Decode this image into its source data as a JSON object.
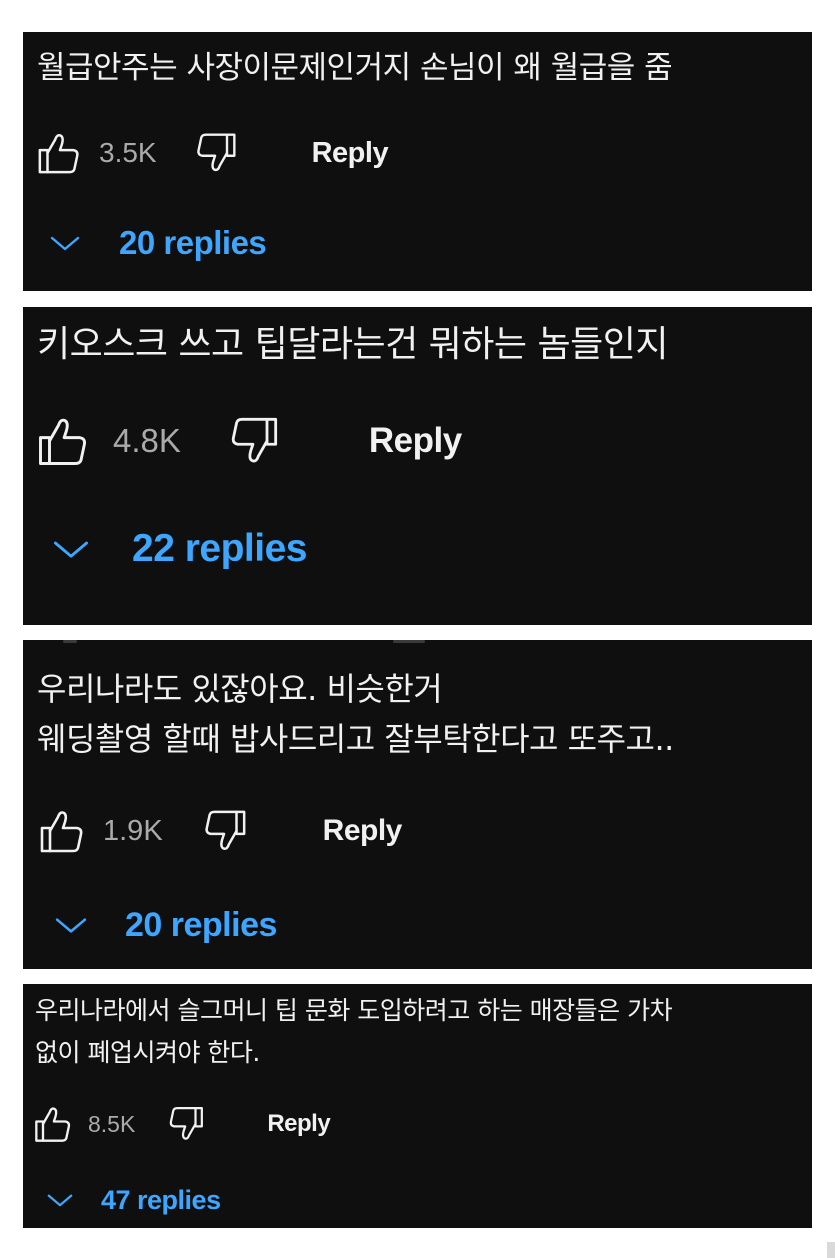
{
  "comments": [
    {
      "lines": [
        "월급안주는 사장이문제인거지 손님이 왜 월급을 줌"
      ],
      "likes": "3.5K",
      "reply_label": "Reply",
      "replies_label": "20 replies",
      "icons": {
        "like": "thumbs-up-icon",
        "dislike": "thumbs-down-icon",
        "expand": "chevron-down-icon"
      }
    },
    {
      "lines": [
        "키오스크 쓰고 팁달라는건 뭐하는 놈들인지"
      ],
      "likes": "4.8K",
      "reply_label": "Reply",
      "replies_label": "22 replies",
      "icons": {
        "like": "thumbs-up-icon",
        "dislike": "thumbs-down-icon",
        "expand": "chevron-down-icon"
      }
    },
    {
      "lines": [
        "우리나라도 있잖아요. 비슷한거",
        "웨딩촬영 할때 밥사드리고 잘부탁한다고 또주고.."
      ],
      "likes": "1.9K",
      "reply_label": "Reply",
      "replies_label": "20 replies",
      "icons": {
        "like": "thumbs-up-icon",
        "dislike": "thumbs-down-icon",
        "expand": "chevron-down-icon"
      }
    },
    {
      "lines": [
        "우리나라에서 슬그머니 팁 문화 도입하려고 하는 매장들은 가차",
        "없이 폐업시켜야 한다."
      ],
      "likes": "8.5K",
      "reply_label": "Reply",
      "replies_label": "47 replies",
      "icons": {
        "like": "thumbs-up-icon",
        "dislike": "thumbs-down-icon",
        "expand": "chevron-down-icon"
      }
    }
  ],
  "colors": {
    "card_background": "#0f0f0f",
    "text": "#f1f1f1",
    "count": "#aaaaaa",
    "link_blue": "#3ea6ff"
  }
}
